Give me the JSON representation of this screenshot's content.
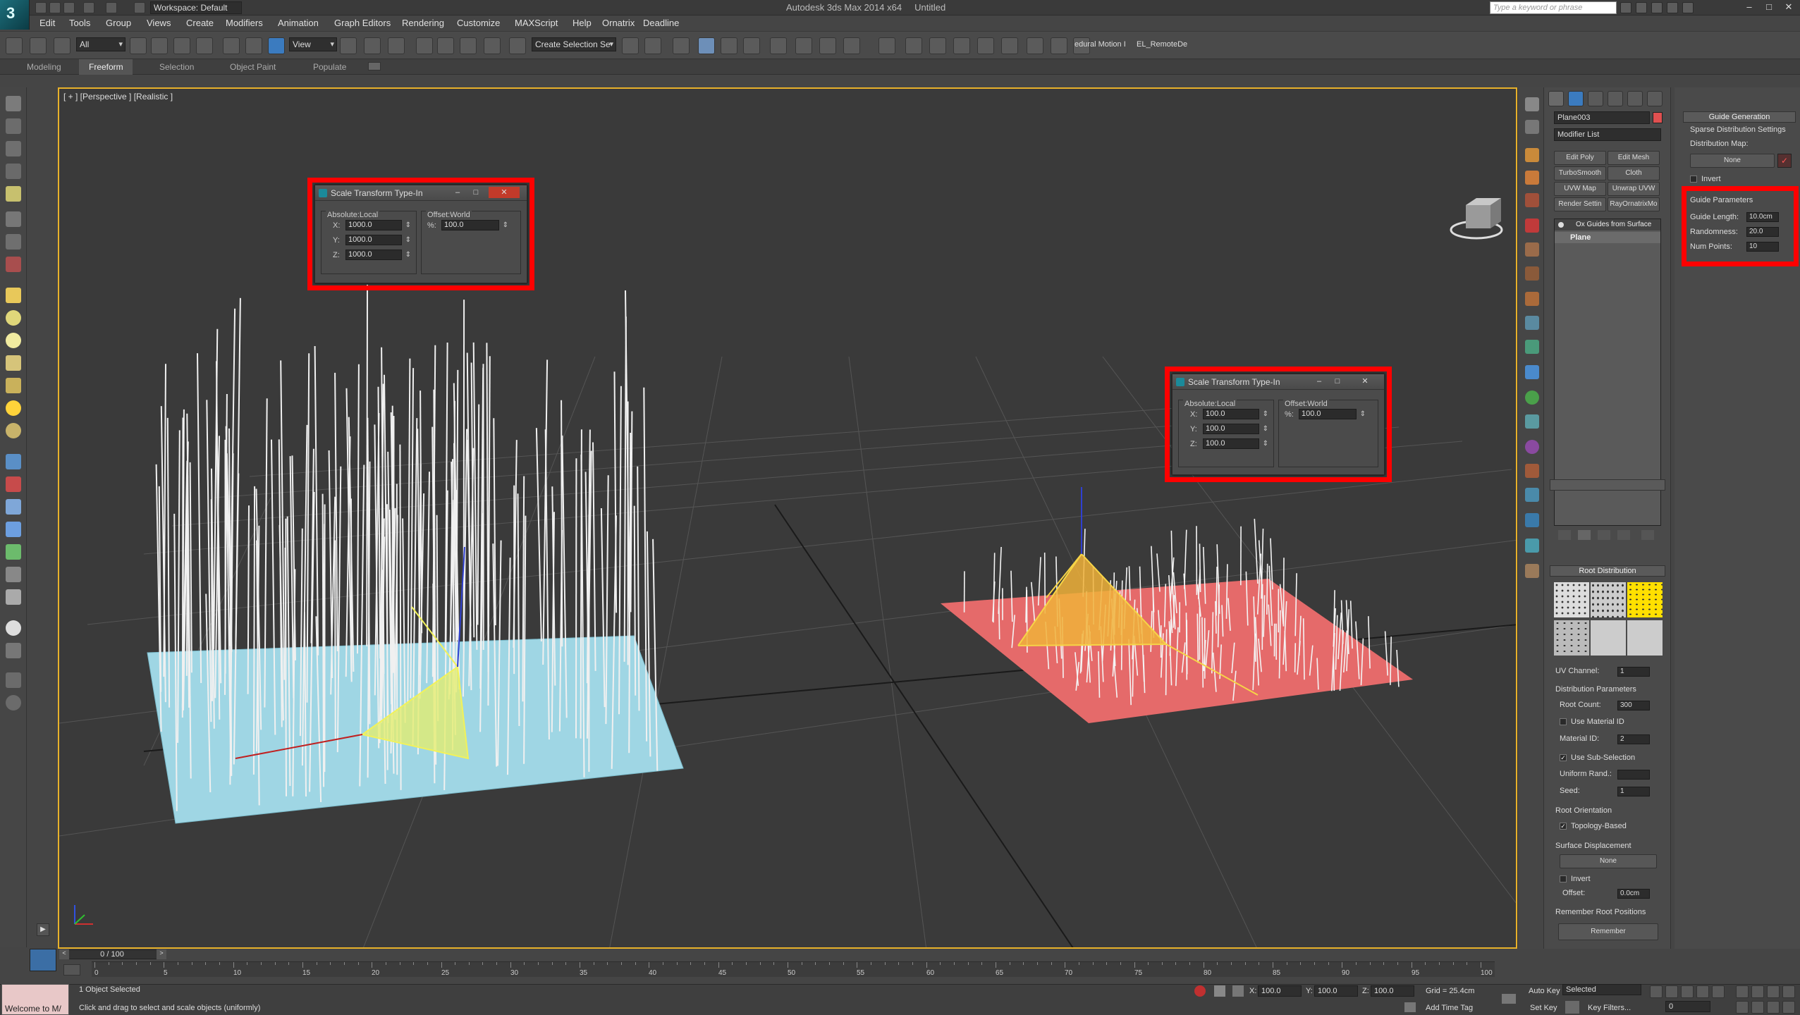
{
  "app": {
    "title": "Autodesk 3ds Max  2014 x64",
    "document": "Untitled",
    "workspace": "Workspace: Default",
    "search_placeholder": "Type a keyword or phrase",
    "logo_letter": "3"
  },
  "menu": [
    "Edit",
    "Tools",
    "Group",
    "Views",
    "Create",
    "Modifiers",
    "Animation",
    "Graph Editors",
    "Rendering",
    "Customize",
    "MAXScript",
    "Help",
    "Ornatrix",
    "Deadline"
  ],
  "toolbar": {
    "selection_filter": "All",
    "ref_coord": "View",
    "named_selection": "Create Selection Se",
    "btn1": "edural Motion I",
    "btn2": "EL_RemoteDe"
  },
  "ribbon_tabs": [
    {
      "label": "Modeling",
      "active": false
    },
    {
      "label": "Freeform",
      "active": true
    },
    {
      "label": "Selection",
      "active": false
    },
    {
      "label": "Object Paint",
      "active": false
    },
    {
      "label": "Populate",
      "active": false
    }
  ],
  "viewport": {
    "label": "[ + ] [Perspective ] [Realistic ]"
  },
  "dialog1": {
    "title": "Scale Transform Type-In",
    "left_group": "Absolute:Local",
    "right_group": "Offset:World",
    "x_label": "X:",
    "y_label": "Y:",
    "z_label": "Z:",
    "x": "1000.0",
    "y": "1000.0",
    "z": "1000.0",
    "pct_label": "%:",
    "pct": "100.0"
  },
  "dialog2": {
    "title": "Scale Transform Type-In",
    "left_group": "Absolute:Local",
    "right_group": "Offset:World",
    "x_label": "X:",
    "y_label": "Y:",
    "z_label": "Z:",
    "x": "100.0",
    "y": "100.0",
    "z": "100.0",
    "pct_label": "%:",
    "pct": "100.0"
  },
  "command_panel": {
    "object_name": "Plane003",
    "modifier_list": "Modifier List",
    "buttons": [
      "Edit Poly",
      "Edit Mesh",
      "TurboSmooth",
      "Cloth",
      "UVW Map",
      "Unwrap UVW",
      "Render Settin",
      "RayOrnatrixMo"
    ],
    "stack_top": "Ox Guides from Surface",
    "stack_base": "Plane",
    "root_dist_title": "Root Distribution",
    "uv_channel_label": "UV Channel:",
    "uv_channel": "1",
    "dist_params_title": "Distribution Parameters",
    "root_count_label": "Root Count:",
    "root_count": "300",
    "use_material_id": "Use Material ID",
    "material_id_label": "Material ID:",
    "material_id": "2",
    "use_sub_selection": "Use Sub-Selection",
    "uniform_rand_label": "Uniform Rand.:",
    "seed_label": "Seed:",
    "seed": "1",
    "root_orient_title": "Root Orientation",
    "topology_based": "Topology-Based",
    "surface_disp_title": "Surface Displacement",
    "none_btn": "None",
    "invert": "Invert",
    "offset_label": "Offset:",
    "offset": "0.0cm",
    "remember_title": "Remember Root Positions",
    "remember_btn": "Remember"
  },
  "guide_panel": {
    "title": "Guide Generation",
    "sparse": "Sparse Distribution Settings",
    "dist_map": "Distribution Map:",
    "none_btn": "None",
    "invert": "Invert",
    "params_title": "Guide Parameters",
    "length_label": "Guide Length:",
    "length": "10.0cm",
    "random_label": "Randomness:",
    "random": "20.0",
    "num_label": "Num Points:",
    "num": "10"
  },
  "timeline": {
    "frame": "0 / 100",
    "ticks": [
      "0",
      "5",
      "10",
      "15",
      "20",
      "25",
      "30",
      "35",
      "40",
      "45",
      "50",
      "55",
      "60",
      "65",
      "70",
      "75",
      "80",
      "85",
      "90",
      "95",
      "100"
    ]
  },
  "status": {
    "welcome": "Welcome to M/",
    "selected": "1 Object Selected",
    "prompt": "Click and drag to select and scale objects (uniformly)",
    "x_label": "X:",
    "x": "100.0",
    "y_label": "Y:",
    "y": "100.0",
    "z_label": "Z:",
    "z": "100.0",
    "grid": "Grid = 25.4cm",
    "add_time_tag": "Add Time Tag",
    "auto_key": "Auto Key",
    "set_key": "Set Key",
    "selected_dd": "Selected",
    "key_filters": "Key Filters...",
    "frame_field": "0"
  },
  "colors": {
    "viewport_border": "#e8b12a",
    "highlight": "#ff0000",
    "plane_blue": "#9fd6e4",
    "plane_red": "#e56a6a",
    "active_tab": "#555555"
  }
}
